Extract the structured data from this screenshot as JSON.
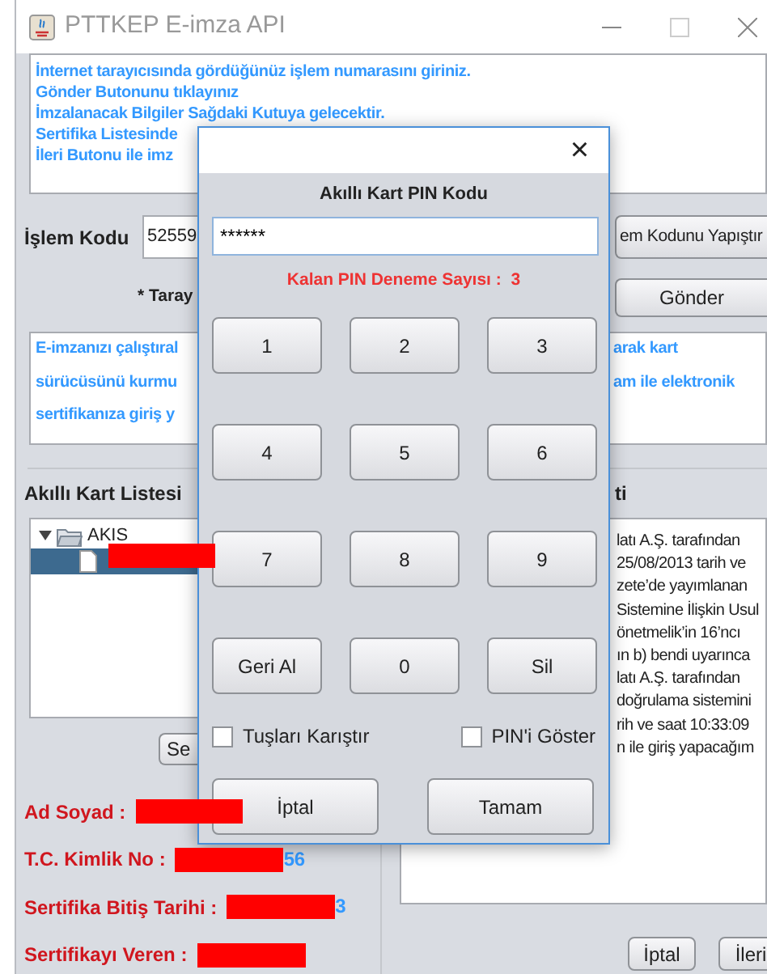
{
  "window": {
    "title": "PTTKEP E-imza API"
  },
  "instructions": {
    "lines": [
      "İnternet tarayıcısında gördüğünüz işlem numarasını giriniz.",
      "Gönder Butonunu tıklayınız",
      "İmzalanacak Bilgiler Sağdaki Kutuya gelecektir.",
      "Sertifika Listesinde",
      "İleri Butonu ile imz"
    ]
  },
  "transaction": {
    "label": "İşlem Kodu",
    "value": "52559",
    "paste_button": "em Kodunu Yapıştır"
  },
  "send_row": {
    "label": "* Taray",
    "button": "Gönder"
  },
  "info_text": {
    "left_lines": [
      "E-imzanızı çalıştıral",
      "sürücüsünü kurmu",
      "sertifikanıza giriş y"
    ],
    "right_lines": [
      "arak kart",
      "am ile elektronik"
    ]
  },
  "card_list": {
    "title": "Akıllı Kart Listesi",
    "tree": [
      {
        "label": "AKIS",
        "expanded": true,
        "children": [
          {
            "selected": true
          }
        ]
      }
    ],
    "button": "Se"
  },
  "certificate_fields": [
    {
      "label": "Ad Soyad :"
    },
    {
      "label": "T.C. Kimlik No :",
      "value_tail": "56"
    },
    {
      "label": "Sertifika Bitiş Tarihi :",
      "value_tail": "3"
    },
    {
      "label": "Sertifikayı Veren :"
    }
  ],
  "details": {
    "title": "ti",
    "lines": [
      "latı A.Ş. tarafından",
      "25/08/2013 tarih ve",
      "zete’de yayımlanan",
      "Sistemine İlişkin Usul",
      "önetmelik’in 16’ncı",
      "ın b) bendi uyarınca",
      "latı A.Ş. tarafından",
      "doğrulama sistemini",
      "rih ve saat 10:33:09",
      "n ile giriş yapacağım"
    ]
  },
  "buttons": [
    "İptal",
    "İleri"
  ],
  "pin_dialog": {
    "close": "×",
    "title": "Akıllı Kart PIN Kodu",
    "pin": "******",
    "attempts_label": "Kalan PIN Deneme Sayısı :",
    "attempts": "3",
    "keys": [
      "1",
      "2",
      "3",
      "4",
      "5",
      "6",
      "7",
      "8",
      "9",
      "Geri Al",
      "0",
      "Sil"
    ],
    "options": [
      {
        "label": "Tuşları Karıştır",
        "checked": false
      },
      {
        "label": "PIN'i Göster",
        "checked": false
      }
    ],
    "buttons": [
      "İptal",
      "Tamam"
    ]
  }
}
